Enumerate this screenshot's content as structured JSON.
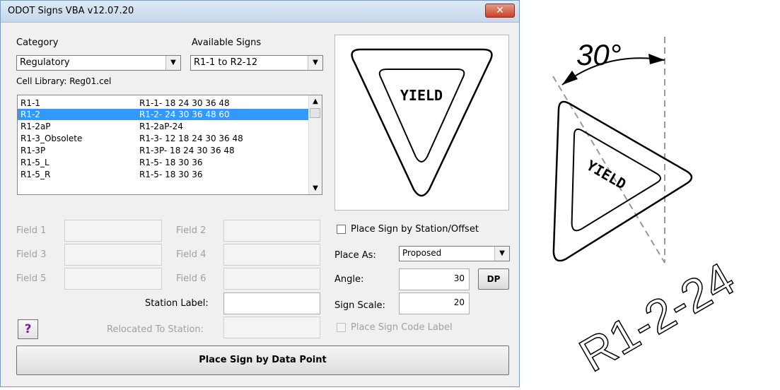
{
  "window": {
    "title": "ODOT Signs VBA  v12.07.20",
    "close_glyph": "✕"
  },
  "category": {
    "label": "Category",
    "value": "Regulatory"
  },
  "available_signs": {
    "label": "Available Signs",
    "value": "R1-1 to R2-12"
  },
  "cell_library": "Cell Library:  Reg01.cel",
  "sign_list": {
    "rows": [
      {
        "name": "R1-1",
        "sizes": "R1-1- 18 24 30 36 48",
        "selected": false
      },
      {
        "name": "R1-2",
        "sizes": "R1-2- 24 30 36 48 60",
        "selected": true
      },
      {
        "name": "R1-2aP",
        "sizes": "R1-2aP-24",
        "selected": false
      },
      {
        "name": "R1-3_Obsolete",
        "sizes": "R1-3- 12 18 24 30 36 48",
        "selected": false
      },
      {
        "name": "R1-3P",
        "sizes": "R1-3P- 18 24 30 36 48",
        "selected": false
      },
      {
        "name": "R1-5_L",
        "sizes": "R1-5- 18 30 36",
        "selected": false
      },
      {
        "name": "R1-5_R",
        "sizes": "R1-5- 18 30 36",
        "selected": false
      }
    ]
  },
  "preview": {
    "sign_text": "YIELD"
  },
  "fields": {
    "field1": "Field 1",
    "field2": "Field 2",
    "field3": "Field 3",
    "field4": "Field 4",
    "field5": "Field 5",
    "field6": "Field 6",
    "station_label": "Station Label:",
    "relocated_to_station": "Relocated To Station:"
  },
  "options": {
    "place_by_station_offset": "Place Sign by Station/Offset",
    "place_as_label": "Place As:",
    "place_as_value": "Proposed",
    "angle_label": "Angle:",
    "angle_value": "30",
    "sign_scale_label": "Sign Scale:",
    "sign_scale_value": "20",
    "place_code_label": "Place Sign Code Label",
    "dp_button": "DP"
  },
  "help_button": "?",
  "place_button": "Place Sign by Data Point",
  "drawing": {
    "angle_text": "30°",
    "sign_text": "YIELD",
    "code_text": "R1-2-24",
    "rotation_degrees": 30
  },
  "colors": {
    "selection": "#3399ff",
    "help_icon": "#7a1f9a",
    "close_button": "#c8412a"
  }
}
